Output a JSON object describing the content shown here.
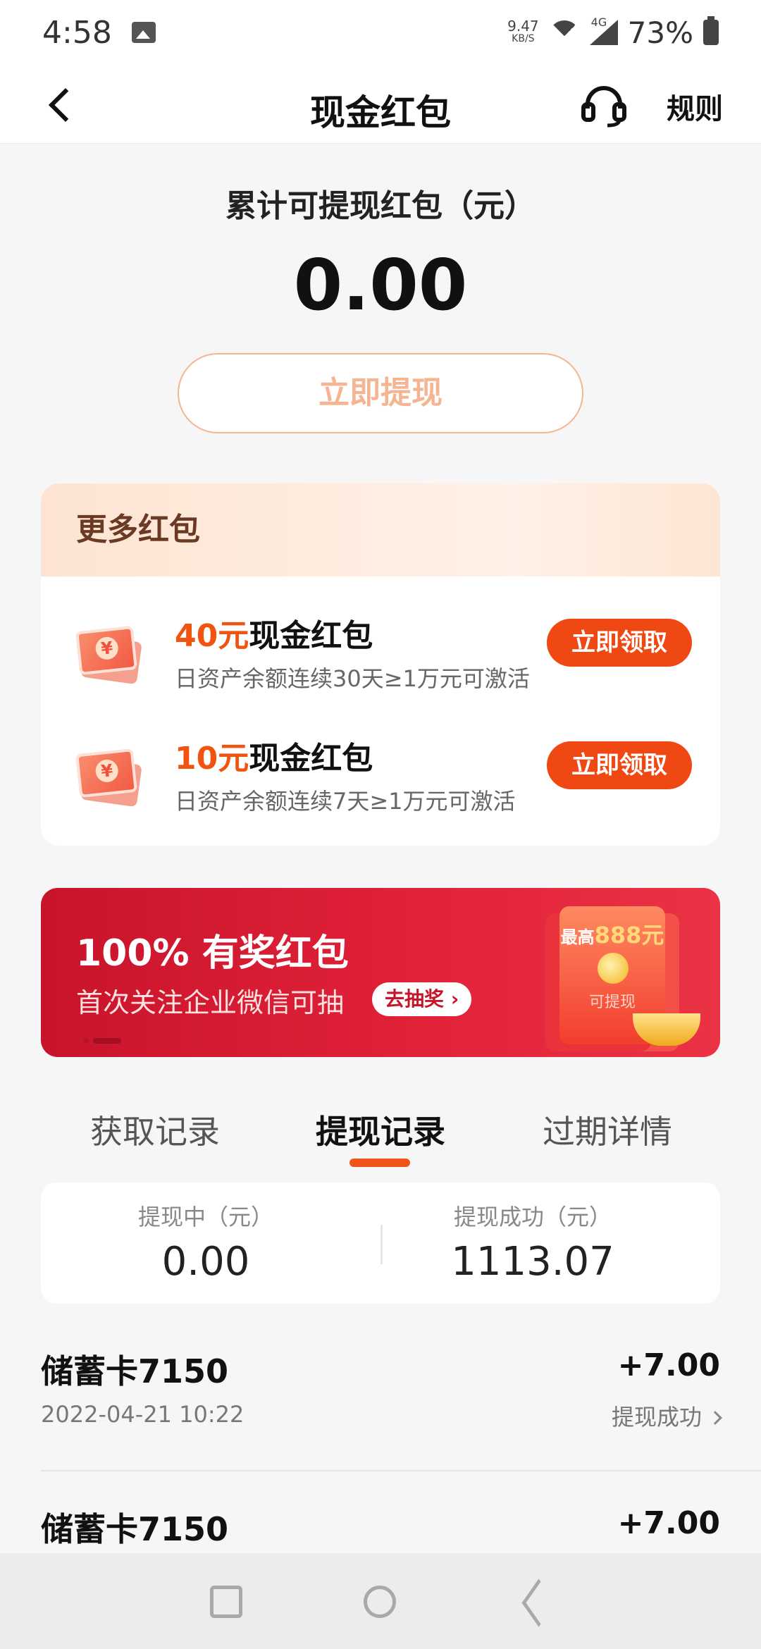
{
  "status_bar": {
    "time": "4:58",
    "net_speed_value": "9.47",
    "net_speed_unit": "KB/S",
    "network_type": "4G",
    "battery": "73%"
  },
  "header": {
    "title": "现金红包",
    "rules_label": "规则"
  },
  "summary": {
    "label": "累计可提现红包（元）",
    "amount": "0.00",
    "withdraw_button": "立即提现"
  },
  "more_packets": {
    "title": "更多红包",
    "items": [
      {
        "amount": "40元",
        "name": "现金红包",
        "desc": "日资产余额连续30天≥1万元可激活",
        "button": "立即领取"
      },
      {
        "amount": "10元",
        "name": "现金红包",
        "desc": "日资产余额连续7天≥1万元可激活",
        "button": "立即领取"
      }
    ]
  },
  "banner": {
    "title": "100% 有奖红包",
    "subtitle": "首次关注企业微信可抽",
    "cta": "去抽奖",
    "art_max_prefix": "最高",
    "art_max_value": "888元",
    "art_label": "可提现"
  },
  "tabs": [
    "获取记录",
    "提现记录",
    "过期详情"
  ],
  "active_tab": 1,
  "stats": {
    "pending_label": "提现中（元）",
    "pending_value": "0.00",
    "success_label": "提现成功（元）",
    "success_value": "1113.07"
  },
  "records": [
    {
      "title": "储蓄卡7150",
      "amount": "+7.00",
      "time": "2022-04-21 10:22",
      "status": "提现成功"
    },
    {
      "title": "储蓄卡7150",
      "amount": "+7.00"
    }
  ],
  "colors": {
    "accent": "#f04812",
    "banner_red": "#d81e32",
    "amount_orange": "#f0540f"
  }
}
